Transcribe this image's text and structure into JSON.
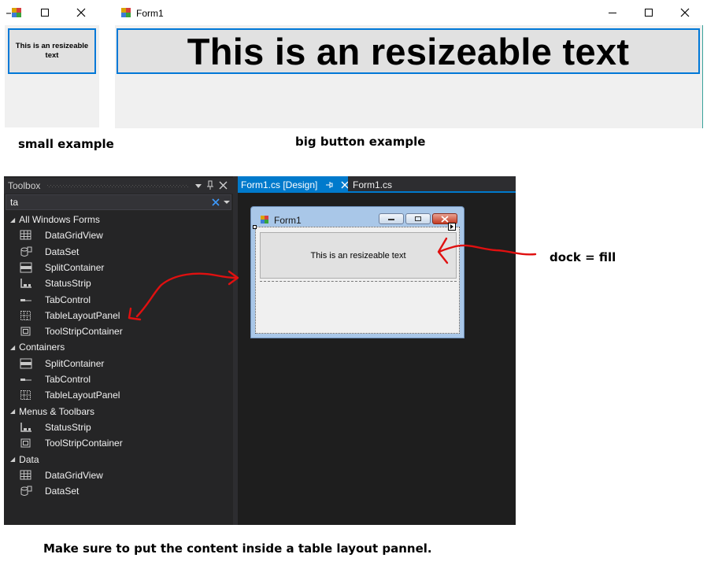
{
  "small_window": {
    "button_text": "This is an resizeable text",
    "caption": "small example"
  },
  "big_window": {
    "title": "Form1",
    "button_text": "This is an resizeable text",
    "caption": "big button example"
  },
  "toolbox": {
    "title": "Toolbox",
    "search_value": "ta",
    "categories": [
      {
        "label": "All Windows Forms",
        "items": [
          {
            "label": "DataGridView",
            "icon": "datagridview-icon"
          },
          {
            "label": "DataSet",
            "icon": "dataset-icon"
          },
          {
            "label": "SplitContainer",
            "icon": "splitcontainer-icon"
          },
          {
            "label": "StatusStrip",
            "icon": "statusstrip-icon"
          },
          {
            "label": "TabControl",
            "icon": "tabcontrol-icon"
          },
          {
            "label": "TableLayoutPanel",
            "icon": "tablelayoutpanel-icon"
          },
          {
            "label": "ToolStripContainer",
            "icon": "toolstripcontainer-icon"
          }
        ]
      },
      {
        "label": "Containers",
        "items": [
          {
            "label": "SplitContainer",
            "icon": "splitcontainer-icon"
          },
          {
            "label": "TabControl",
            "icon": "tabcontrol-icon"
          },
          {
            "label": "TableLayoutPanel",
            "icon": "tablelayoutpanel-icon"
          }
        ]
      },
      {
        "label": "Menus & Toolbars",
        "items": [
          {
            "label": "StatusStrip",
            "icon": "statusstrip-icon"
          },
          {
            "label": "ToolStripContainer",
            "icon": "toolstripcontainer-icon"
          }
        ]
      },
      {
        "label": "Data",
        "items": [
          {
            "label": "DataGridView",
            "icon": "datagridview-icon"
          },
          {
            "label": "DataSet",
            "icon": "dataset-icon"
          }
        ]
      }
    ]
  },
  "editor": {
    "tabs": [
      {
        "label": "Form1.cs [Design]",
        "active": true
      },
      {
        "label": "Form1.cs",
        "active": false
      }
    ],
    "designer_form_title": "Form1",
    "designer_button_text": "This is an resizeable text"
  },
  "annotations": {
    "dock_fill": "dock = fill",
    "instruction": "Make sure to put the content inside a table layout pannel."
  },
  "colors": {
    "accent_blue": "#0078d7",
    "vs_blue": "#007acc",
    "vs_dark": "#252526",
    "arrow_red": "#e01010"
  }
}
